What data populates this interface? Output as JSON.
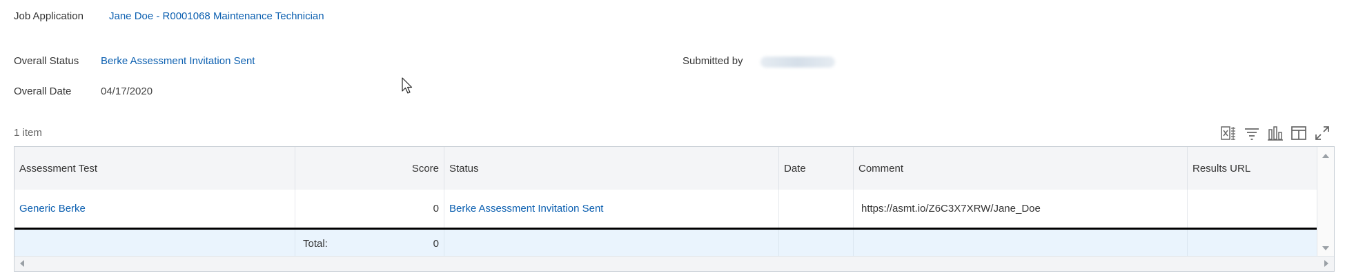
{
  "header": {
    "job_application_label": "Job Application",
    "job_application_value": "Jane Doe - R0001068 Maintenance Technician",
    "overall_status_label": "Overall Status",
    "overall_status_value": "Berke Assessment Invitation Sent",
    "submitted_by_label": "Submitted by",
    "overall_date_label": "Overall Date",
    "overall_date_value": "04/17/2020"
  },
  "grid": {
    "item_count": "1 item",
    "toolbar_icons": [
      "export-excel-icon",
      "filter-icon",
      "chart-icon",
      "column-layout-icon",
      "fullscreen-icon"
    ],
    "columns": [
      "Assessment Test",
      "Score",
      "Status",
      "Date",
      "Comment",
      "Results URL"
    ],
    "rows": [
      {
        "assessment_test": "Generic Berke",
        "score": "0",
        "status": "Berke Assessment Invitation Sent",
        "date": "",
        "comment": "https://asmt.io/Z6C3X7XRW/Jane_Doe",
        "results_url": ""
      }
    ],
    "total_label": "Total:",
    "total_score": "0"
  },
  "colors": {
    "link": "#0b5fb0",
    "header_bg": "#f4f5f7",
    "total_row_bg": "#eaf4fd"
  }
}
